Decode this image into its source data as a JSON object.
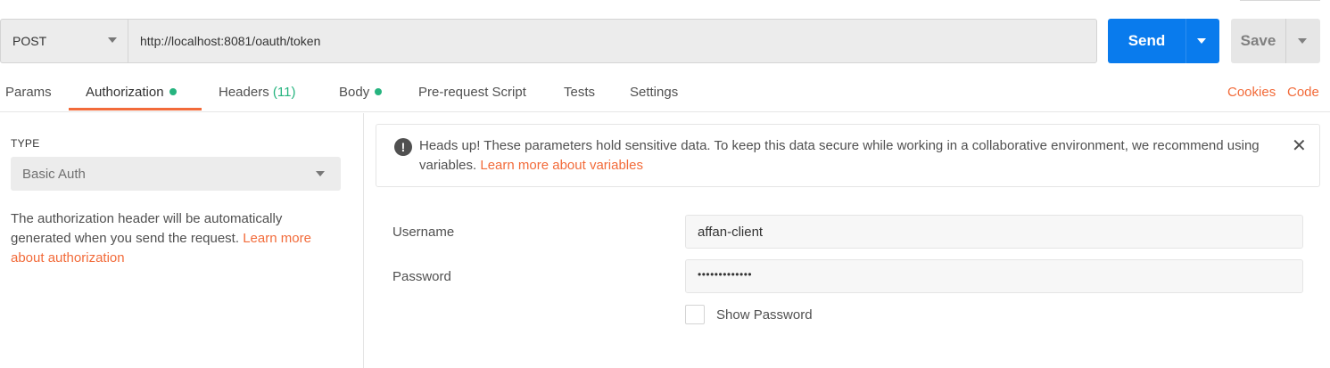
{
  "request": {
    "method": "POST",
    "url": "http://localhost:8081/oauth/token",
    "send_label": "Send",
    "save_label": "Save"
  },
  "tabs": [
    {
      "label": "Params"
    },
    {
      "label": "Authorization",
      "dot": true,
      "active": true
    },
    {
      "label": "Headers",
      "count": "(11)"
    },
    {
      "label": "Body",
      "dot": true
    },
    {
      "label": "Pre-request Script"
    },
    {
      "label": "Tests"
    },
    {
      "label": "Settings"
    }
  ],
  "right_links": {
    "cookies": "Cookies",
    "code": "Code"
  },
  "auth": {
    "type_label": "TYPE",
    "type_value": "Basic Auth",
    "description": "The authorization header will be automatically generated when you send the request.",
    "learn_more": "Learn more about authorization"
  },
  "notice": {
    "text": "Heads up! These parameters hold sensitive data. To keep this data secure while working in a collaborative environment, we recommend using variables.",
    "link": "Learn more about variables"
  },
  "form": {
    "username_label": "Username",
    "username_value": "affan-client",
    "password_label": "Password",
    "password_value": "•••••••••••••",
    "show_password_label": "Show Password"
  },
  "colors": {
    "accent": "#f26b3a",
    "send": "#097bed",
    "green": "#26b47f"
  }
}
